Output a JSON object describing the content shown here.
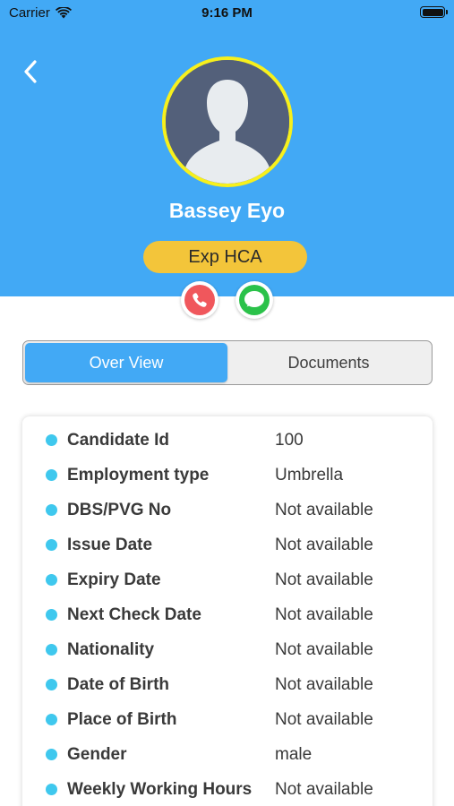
{
  "status_bar": {
    "carrier": "Carrier",
    "time": "9:16 PM"
  },
  "profile": {
    "name": "Bassey Eyo",
    "role": "Exp HCA",
    "avatar_icon": "person-silhouette-icon"
  },
  "actions": {
    "call_icon": "phone-icon",
    "chat_icon": "chat-bubble-icon"
  },
  "tabs": [
    {
      "label": "Over View",
      "active": true
    },
    {
      "label": "Documents",
      "active": false
    }
  ],
  "details": [
    {
      "label": "Candidate Id",
      "value": "100"
    },
    {
      "label": "Employment type",
      "value": "Umbrella"
    },
    {
      "label": "DBS/PVG No",
      "value": "Not available"
    },
    {
      "label": "Issue Date",
      "value": "Not available"
    },
    {
      "label": "Expiry Date",
      "value": "Not available"
    },
    {
      "label": "Next Check Date",
      "value": "Not available"
    },
    {
      "label": "Nationality",
      "value": "Not available"
    },
    {
      "label": "Date of Birth",
      "value": "Not available"
    },
    {
      "label": "Place of Birth",
      "value": "Not available"
    },
    {
      "label": "Gender",
      "value": "male"
    },
    {
      "label": "Weekly Working Hours",
      "value": "Not available"
    }
  ],
  "colors": {
    "header": "#42a9f5",
    "avatar_ring": "#f7f01c",
    "badge": "#f3c53a",
    "call": "#f0575c",
    "chat": "#2bc24a",
    "bullet": "#3fc8ee"
  }
}
